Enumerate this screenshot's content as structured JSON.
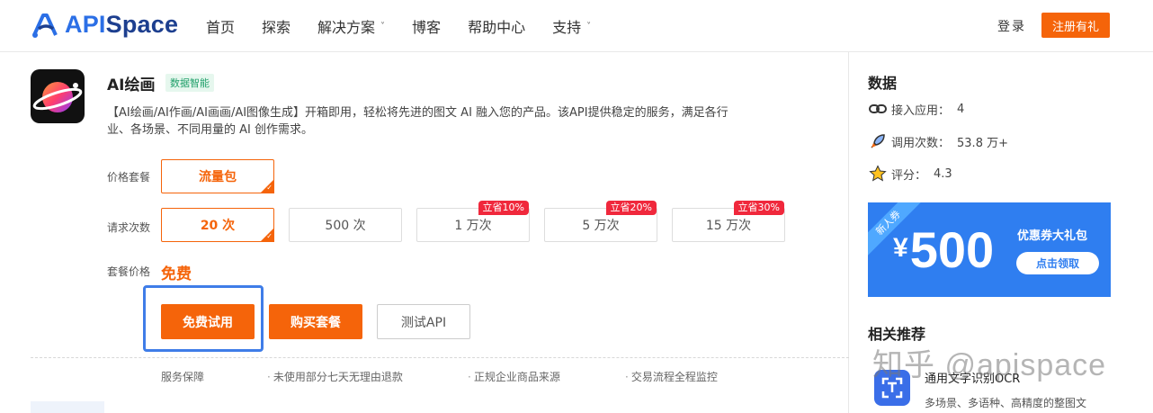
{
  "header": {
    "logo_text_a": "API",
    "logo_text_b": "Space",
    "nav": [
      {
        "label": "首页",
        "has_dropdown": false
      },
      {
        "label": "探索",
        "has_dropdown": false
      },
      {
        "label": "解决方案",
        "has_dropdown": true
      },
      {
        "label": "博客",
        "has_dropdown": false
      },
      {
        "label": "帮助中心",
        "has_dropdown": false
      },
      {
        "label": "支持",
        "has_dropdown": true
      }
    ],
    "dropdown_glyph": "˅",
    "login": "登录",
    "register": "注册有礼"
  },
  "product": {
    "title": "AI绘画",
    "tag": "数据智能",
    "description": "【AI绘画/AI作画/AI画画/AI图像生成】开箱即用，轻松将先进的图文 AI 融入您的产品。该API提供稳定的服务，满足各行业、各场景、不同用量的 AI 创作需求。",
    "package_label": "价格套餐",
    "package_option": "流量包",
    "requests_label": "请求次数",
    "request_options": [
      {
        "label": "20 次",
        "selected": true,
        "discount": ""
      },
      {
        "label": "500 次",
        "selected": false,
        "discount": ""
      },
      {
        "label": "1 万次",
        "selected": false,
        "discount": "立省10%"
      },
      {
        "label": "5 万次",
        "selected": false,
        "discount": "立省20%"
      },
      {
        "label": "15 万次",
        "selected": false,
        "discount": "立省30%"
      }
    ],
    "price_label": "套餐价格",
    "price_value": "免费",
    "buttons": {
      "free_trial": "免费试用",
      "buy": "购买套餐",
      "test_api": "测试API"
    },
    "guarantees": [
      "服务保障",
      "未使用部分七天无理由退款",
      "正规企业商品来源",
      "交易流程全程监控"
    ]
  },
  "sidebar": {
    "data_title": "数据",
    "stats": [
      {
        "icon": "link-icon",
        "label": "接入应用：",
        "value": "4"
      },
      {
        "icon": "rocket-icon",
        "label": "调用次数：",
        "value": "53.8 万+"
      },
      {
        "icon": "star-icon",
        "label": "评分：",
        "value": "4.3"
      }
    ],
    "coupon": {
      "ribbon": "新人券",
      "currency": "¥",
      "amount": "500",
      "caption": "优惠券大礼包",
      "claim": "点击领取"
    },
    "related_title": "相关推荐",
    "related": {
      "title": "通用文字识别OCR",
      "desc": "多场景、多语种、高精度的整图文"
    }
  },
  "watermark": "知乎 @apispace",
  "colors": {
    "accent": "#f5640a",
    "brand_blue": "#2b6fe6",
    "discount_red": "#f0283c",
    "coupon_blue": "#2f7ef0",
    "highlight": "#3f7de8"
  }
}
